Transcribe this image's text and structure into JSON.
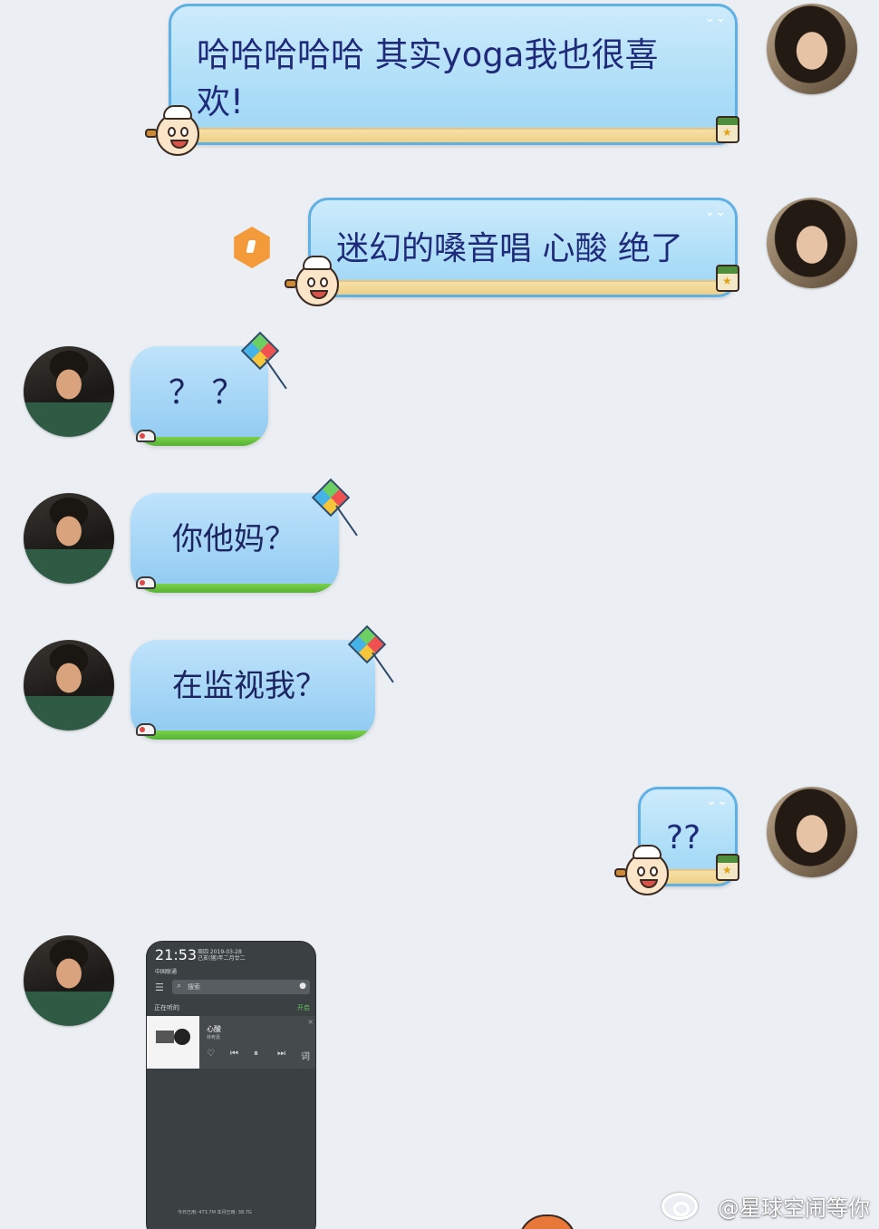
{
  "messages": [
    {
      "side": "right",
      "text": "哈哈哈哈哈 其实yoga我也很喜欢!"
    },
    {
      "side": "right",
      "text": "迷幻的嗓音唱 心酸 绝了"
    },
    {
      "side": "left",
      "text": "？？"
    },
    {
      "side": "left",
      "text": "你他妈？"
    },
    {
      "side": "left",
      "text": "在监视我？"
    },
    {
      "side": "right",
      "text": "??"
    },
    {
      "side": "left",
      "type": "image",
      "text": "phone screenshot"
    }
  ],
  "msg1": {
    "line1": "哈哈哈哈哈 其实yoga我也很喜",
    "line2": "欢!"
  },
  "msg2": {
    "text": "迷幻的嗓音唱 心酸 绝了"
  },
  "msg3": {
    "text": "？ ？"
  },
  "msg4": {
    "text": "你他妈？"
  },
  "msg5": {
    "text": "在监视我？"
  },
  "msg6": {
    "text": "??"
  },
  "screenshot": {
    "time": "21:53",
    "date_line1": "周四 2019-03-28",
    "date_line2": "己亥(猪)年二月廿二",
    "carrier": "中国联通",
    "search_placeholder": "搜索",
    "section_label": "正在听的",
    "section_action": "开启",
    "song_title": "心酸",
    "song_artist": "林宥嘉",
    "lyrics_btn": "词",
    "footer": "今日已用: 473.7M  本月已用: 38.7G"
  },
  "watermark": "@星球空闹等你",
  "icons": [
    "sailor-mascot",
    "spinach-can",
    "kite",
    "seagull",
    "shoe",
    "hexagon-status"
  ],
  "colors": {
    "background": "#ebeef2",
    "right_bubble": "#a9dcf7",
    "left_bubble": "#8fcaf1",
    "text": "#1f2a7a",
    "status_orange": "#f39a3a"
  }
}
